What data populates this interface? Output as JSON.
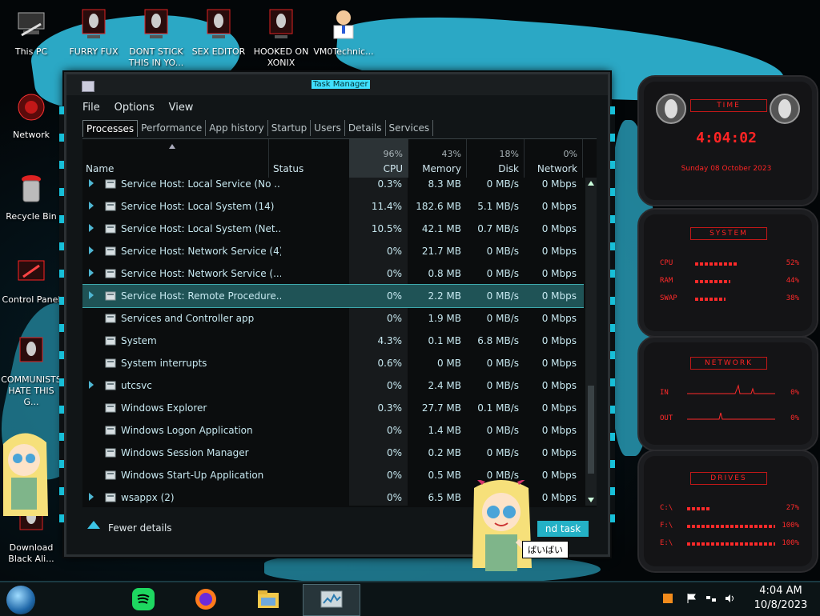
{
  "desktop": {
    "icons": [
      {
        "label": "This PC"
      },
      {
        "label": "FURRY FUX"
      },
      {
        "label": "DONT STICK THIS IN YO..."
      },
      {
        "label": "SEX EDITOR"
      },
      {
        "label": "HOOKED ON XONIX"
      },
      {
        "label": "VM0Technic..."
      },
      {
        "label": "Network"
      },
      {
        "label": "Recycle Bin"
      },
      {
        "label": "Control Panel"
      },
      {
        "label": "COMMUNISTS HATE THIS G..."
      },
      {
        "label": "Download Black Ali..."
      }
    ]
  },
  "task_manager": {
    "title": "Task Manager",
    "menu": [
      "File",
      "Options",
      "View"
    ],
    "tabs": [
      "Processes",
      "Performance",
      "App history",
      "Startup",
      "Users",
      "Details",
      "Services"
    ],
    "active_tab": "Processes",
    "columns": {
      "name": "Name",
      "status": "Status",
      "cpu": {
        "pct": "96%",
        "label": "CPU"
      },
      "memory": {
        "pct": "43%",
        "label": "Memory"
      },
      "disk": {
        "pct": "18%",
        "label": "Disk"
      },
      "network": {
        "pct": "0%",
        "label": "Network"
      }
    },
    "rows": [
      {
        "name": "Service Host: Local Service (No ...",
        "cpu": "0.3%",
        "mem": "8.3 MB",
        "disk": "0 MB/s",
        "net": "0 Mbps",
        "expand": true
      },
      {
        "name": "Service Host: Local System (14)",
        "cpu": "11.4%",
        "mem": "182.6 MB",
        "disk": "5.1 MB/s",
        "net": "0 Mbps",
        "expand": true
      },
      {
        "name": "Service Host: Local System (Net...",
        "cpu": "10.5%",
        "mem": "42.1 MB",
        "disk": "0.7 MB/s",
        "net": "0 Mbps",
        "expand": true
      },
      {
        "name": "Service Host: Network Service (4)",
        "cpu": "0%",
        "mem": "21.7 MB",
        "disk": "0 MB/s",
        "net": "0 Mbps",
        "expand": true
      },
      {
        "name": "Service Host: Network Service (...",
        "cpu": "0%",
        "mem": "0.8 MB",
        "disk": "0 MB/s",
        "net": "0 Mbps",
        "expand": true
      },
      {
        "name": "Service Host: Remote Procedure...",
        "cpu": "0%",
        "mem": "2.2 MB",
        "disk": "0 MB/s",
        "net": "0 Mbps",
        "expand": true,
        "selected": true
      },
      {
        "name": "Services and Controller app",
        "cpu": "0%",
        "mem": "1.9 MB",
        "disk": "0 MB/s",
        "net": "0 Mbps",
        "expand": false
      },
      {
        "name": "System",
        "cpu": "4.3%",
        "mem": "0.1 MB",
        "disk": "6.8 MB/s",
        "net": "0 Mbps",
        "expand": false
      },
      {
        "name": "System interrupts",
        "cpu": "0.6%",
        "mem": "0 MB",
        "disk": "0 MB/s",
        "net": "0 Mbps",
        "expand": false
      },
      {
        "name": "utcsvc",
        "cpu": "0%",
        "mem": "2.4 MB",
        "disk": "0 MB/s",
        "net": "0 Mbps",
        "expand": true
      },
      {
        "name": "Windows Explorer",
        "cpu": "0.3%",
        "mem": "27.7 MB",
        "disk": "0.1 MB/s",
        "net": "0 Mbps",
        "expand": false
      },
      {
        "name": "Windows Logon Application",
        "cpu": "0%",
        "mem": "1.4 MB",
        "disk": "0 MB/s",
        "net": "0 Mbps",
        "expand": false
      },
      {
        "name": "Windows Session Manager",
        "cpu": "0%",
        "mem": "0.2 MB",
        "disk": "0 MB/s",
        "net": "0 Mbps",
        "expand": false
      },
      {
        "name": "Windows Start-Up Application",
        "cpu": "0%",
        "mem": "0.5 MB",
        "disk": "0 MB/s",
        "net": "0 Mbps",
        "expand": false
      },
      {
        "name": "wsappx (2)",
        "cpu": "0%",
        "mem": "6.5 MB",
        "disk": "0 MB/s",
        "net": "0 Mbps",
        "expand": true
      }
    ],
    "fewer_details": "Fewer details",
    "end_task": "End task",
    "end_task_visible": "nd task"
  },
  "gadgets": {
    "time": {
      "title": "TIME",
      "clock": "4:04:02",
      "date": "Sunday 08 October 2023"
    },
    "system": {
      "title": "SYSTEM",
      "cpu_label": "CPU",
      "cpu_val": "52%",
      "cpu": 0.52,
      "ram_label": "RAM",
      "ram_val": "44%",
      "ram": 0.44,
      "swap_label": "SWAP",
      "swap_val": "38%",
      "swap": 0.38
    },
    "network": {
      "title": "NETWORK",
      "in_label": "IN",
      "in_val": "0%",
      "out_label": "OUT",
      "out_val": "0%"
    },
    "drives": {
      "title": "DRIVES",
      "items": [
        {
          "label": "C:\\",
          "val": "27%",
          "frac": 0.27
        },
        {
          "label": "F:\\",
          "val": "100%",
          "frac": 1.0
        },
        {
          "label": "E:\\",
          "val": "100%",
          "frac": 1.0
        }
      ]
    }
  },
  "sticker": {
    "bubble": "ばいばい"
  },
  "taskbar": {
    "time": "4:04 AM",
    "date": "10/8/2023"
  },
  "colors": {
    "accent": "#2fb6d6",
    "gadget_red": "#ff2a2a",
    "selection": "#1f5356"
  }
}
